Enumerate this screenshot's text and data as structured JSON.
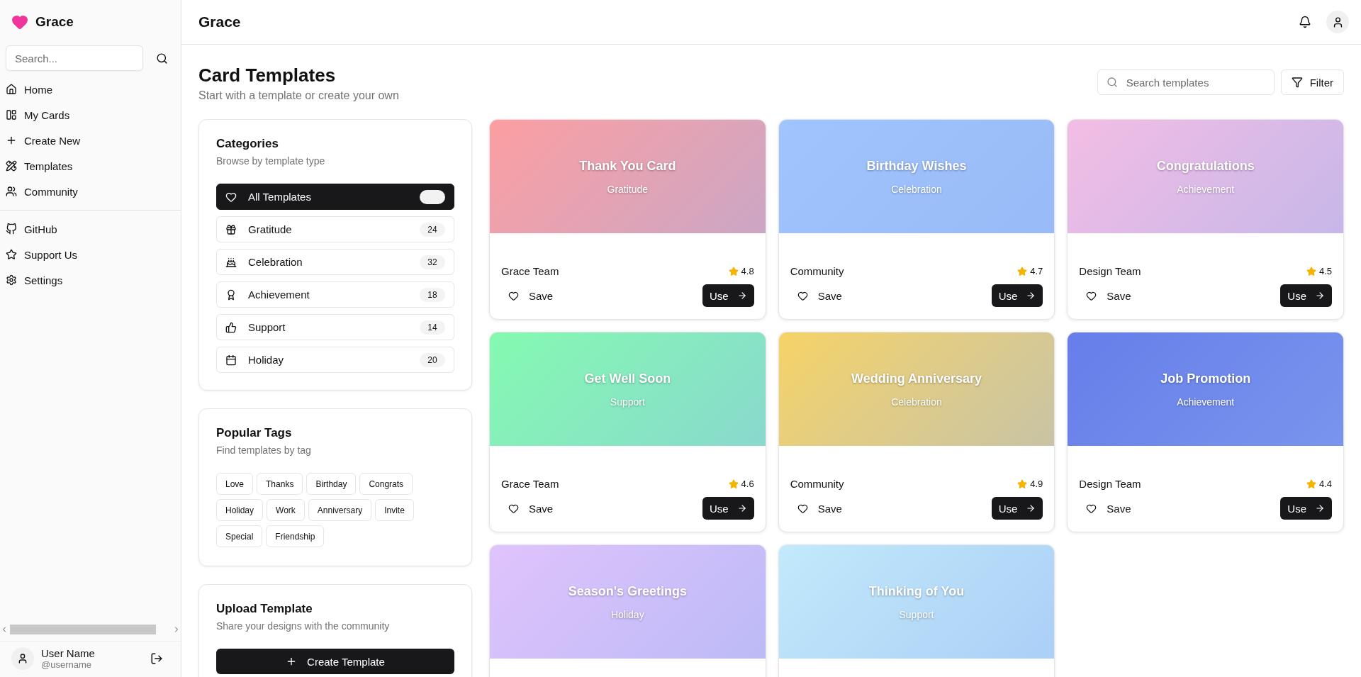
{
  "sidebar": {
    "brand": "Grace",
    "search": {
      "placeholder": "Search..."
    },
    "nav": [
      {
        "label": "Home"
      },
      {
        "label": "My Cards"
      },
      {
        "label": "Create New"
      },
      {
        "label": "Templates"
      },
      {
        "label": "Community"
      }
    ],
    "secondary_nav": [
      {
        "label": "GitHub"
      },
      {
        "label": "Support Us"
      },
      {
        "label": "Settings"
      }
    ],
    "user": {
      "name": "User Name",
      "handle": "@username"
    }
  },
  "header": {
    "title": "Grace"
  },
  "page": {
    "title": "Card Templates",
    "subtitle": "Start with a template or create your own",
    "search": {
      "placeholder": "Search templates"
    },
    "filter_button": "Filter"
  },
  "categories": {
    "title": "Categories",
    "subtitle": "Browse by template type",
    "items": [
      {
        "label": "All Templates",
        "selected": true
      },
      {
        "label": "Gratitude",
        "count": "24",
        "selected": false
      },
      {
        "label": "Celebration",
        "count": "32",
        "selected": false
      },
      {
        "label": "Achievement",
        "count": "18",
        "selected": false
      },
      {
        "label": "Support",
        "count": "14",
        "selected": false
      },
      {
        "label": "Holiday",
        "count": "20",
        "selected": false
      }
    ]
  },
  "tags": {
    "title": "Popular Tags",
    "subtitle": "Find templates by tag",
    "items": [
      "Love",
      "Thanks",
      "Birthday",
      "Congrats",
      "Holiday",
      "Work",
      "Anniversary",
      "Invite",
      "Special",
      "Friendship"
    ]
  },
  "upload": {
    "title": "Upload Template",
    "subtitle": "Share your designs with the community",
    "button": "Create Template"
  },
  "templates": [
    {
      "title": "Thank You Card",
      "category": "Gratitude",
      "color": "#fc9ea1",
      "author": "Grace Team",
      "rating": "4.8",
      "save": "Save",
      "use": "Use"
    },
    {
      "title": "Birthday Wishes",
      "category": "Celebration",
      "color": "#a0c4fd",
      "author": "Community",
      "rating": "4.7",
      "save": "Save",
      "use": "Use"
    },
    {
      "title": "Congratulations",
      "category": "Achievement",
      "color": "#f3bde4",
      "author": "Design Team",
      "rating": "4.5",
      "save": "Save",
      "use": "Use"
    },
    {
      "title": "Get Well Soon",
      "category": "Support",
      "color": "#84fab0",
      "author": "Grace Team",
      "rating": "4.6",
      "save": "Save",
      "use": "Use"
    },
    {
      "title": "Wedding Anniversary",
      "category": "Celebration",
      "color": "#f6d365",
      "author": "Community",
      "rating": "4.9",
      "save": "Save",
      "use": "Use"
    },
    {
      "title": "Job Promotion",
      "category": "Achievement",
      "color": "#667eea",
      "author": "Design Team",
      "rating": "4.4",
      "save": "Save",
      "use": "Use"
    },
    {
      "title": "Season's Greetings",
      "category": "Holiday",
      "color": "#e0c3fc"
    },
    {
      "title": "Thinking of You",
      "category": "Support",
      "color": "#c2e9fb"
    }
  ]
}
